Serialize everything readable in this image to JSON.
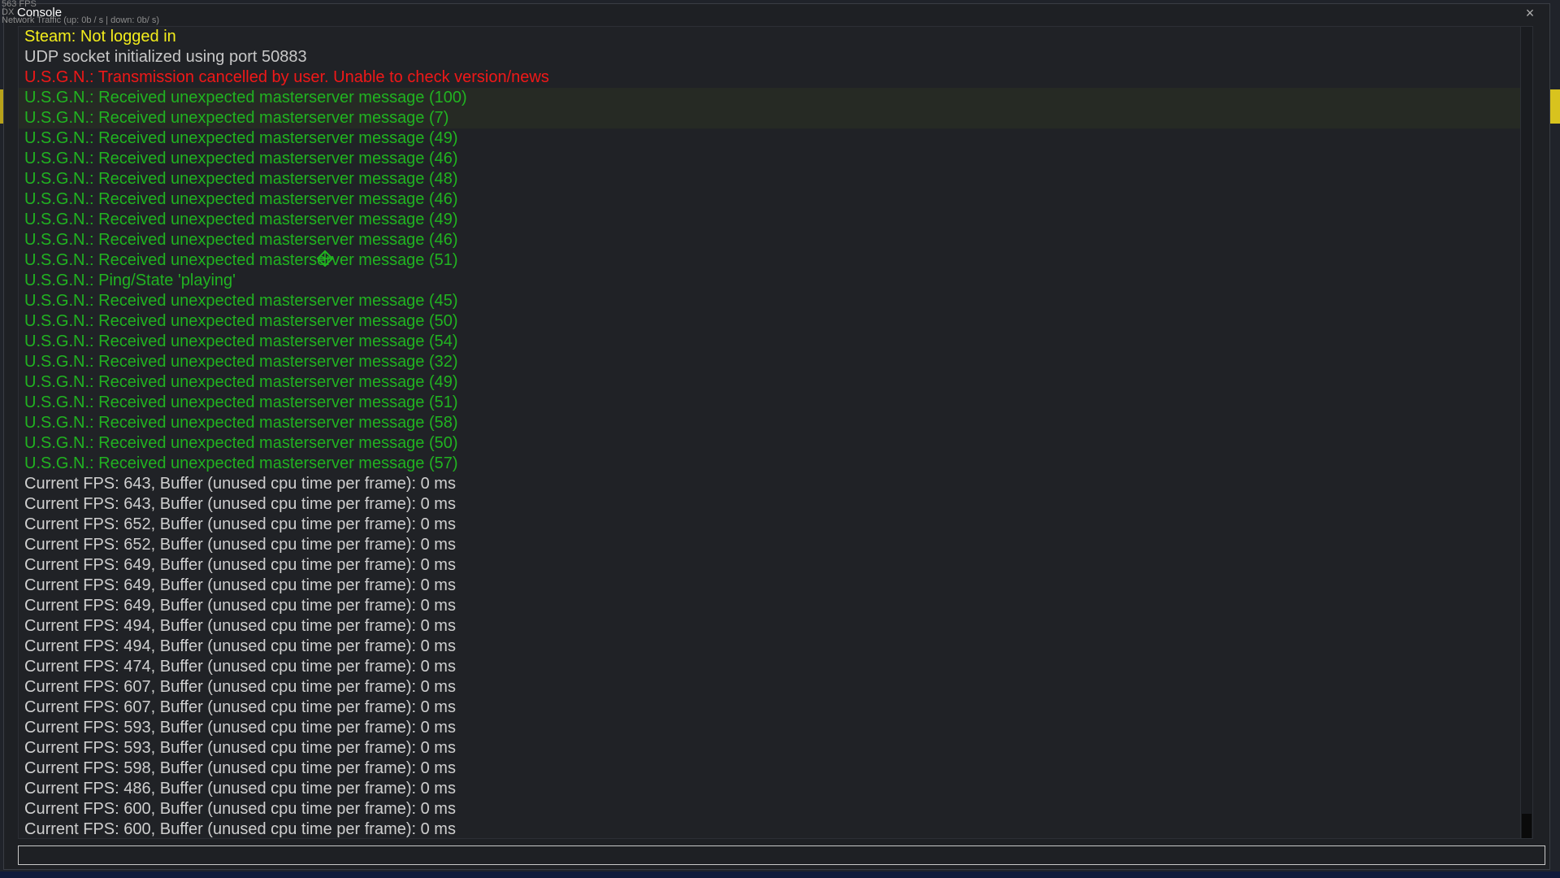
{
  "hud": {
    "fps": "563 FPS",
    "renderer": "DX",
    "network": "Network Traffic (up: 0b / s | down: 0b/ s)"
  },
  "window": {
    "title": "Console",
    "close_label": "×"
  },
  "colors": {
    "yellow": "#f4ee1c",
    "gray": "#c8c8c8",
    "red": "#f01818",
    "green": "#21b321"
  },
  "log": [
    {
      "text": "Steam: Not logged in",
      "color": "yellow"
    },
    {
      "text": "UDP socket initialized using port 50883",
      "color": "gray"
    },
    {
      "text": "U.S.G.N.: Transmission cancelled by user. Unable to check version/news",
      "color": "red"
    },
    {
      "text": "U.S.G.N.: Received unexpected masterserver message (100)",
      "color": "green",
      "highlight": true
    },
    {
      "text": "U.S.G.N.: Received unexpected masterserver message (7)",
      "color": "green",
      "highlight": true
    },
    {
      "text": "U.S.G.N.: Received unexpected masterserver message (49)",
      "color": "green"
    },
    {
      "text": "U.S.G.N.: Received unexpected masterserver message (46)",
      "color": "green"
    },
    {
      "text": "U.S.G.N.: Received unexpected masterserver message (48)",
      "color": "green"
    },
    {
      "text": "U.S.G.N.: Received unexpected masterserver message (46)",
      "color": "green"
    },
    {
      "text": "U.S.G.N.: Received unexpected masterserver message (49)",
      "color": "green"
    },
    {
      "text": "U.S.G.N.: Received unexpected masterserver message (46)",
      "color": "green"
    },
    {
      "text": "U.S.G.N.: Received unexpected masterserver message (51)",
      "color": "green"
    },
    {
      "text": "U.S.G.N.: Ping/State 'playing'",
      "color": "green"
    },
    {
      "text": "U.S.G.N.: Received unexpected masterserver message (45)",
      "color": "green"
    },
    {
      "text": "U.S.G.N.: Received unexpected masterserver message (50)",
      "color": "green"
    },
    {
      "text": "U.S.G.N.: Received unexpected masterserver message (54)",
      "color": "green"
    },
    {
      "text": "U.S.G.N.: Received unexpected masterserver message (32)",
      "color": "green"
    },
    {
      "text": "U.S.G.N.: Received unexpected masterserver message (49)",
      "color": "green"
    },
    {
      "text": "U.S.G.N.: Received unexpected masterserver message (51)",
      "color": "green"
    },
    {
      "text": "U.S.G.N.: Received unexpected masterserver message (58)",
      "color": "green"
    },
    {
      "text": "U.S.G.N.: Received unexpected masterserver message (50)",
      "color": "green"
    },
    {
      "text": "U.S.G.N.: Received unexpected masterserver message (57)",
      "color": "green"
    },
    {
      "text": "Current FPS: 643, Buffer (unused cpu time per frame): 0 ms",
      "color": "white"
    },
    {
      "text": "Current FPS: 643, Buffer (unused cpu time per frame): 0 ms",
      "color": "white"
    },
    {
      "text": "Current FPS: 652, Buffer (unused cpu time per frame): 0 ms",
      "color": "white"
    },
    {
      "text": "Current FPS: 652, Buffer (unused cpu time per frame): 0 ms",
      "color": "white"
    },
    {
      "text": "Current FPS: 649, Buffer (unused cpu time per frame): 0 ms",
      "color": "white"
    },
    {
      "text": "Current FPS: 649, Buffer (unused cpu time per frame): 0 ms",
      "color": "white"
    },
    {
      "text": "Current FPS: 649, Buffer (unused cpu time per frame): 0 ms",
      "color": "white"
    },
    {
      "text": "Current FPS: 494, Buffer (unused cpu time per frame): 0 ms",
      "color": "white"
    },
    {
      "text": "Current FPS: 494, Buffer (unused cpu time per frame): 0 ms",
      "color": "white"
    },
    {
      "text": "Current FPS: 474, Buffer (unused cpu time per frame): 0 ms",
      "color": "white"
    },
    {
      "text": "Current FPS: 607, Buffer (unused cpu time per frame): 0 ms",
      "color": "white"
    },
    {
      "text": "Current FPS: 607, Buffer (unused cpu time per frame): 0 ms",
      "color": "white"
    },
    {
      "text": "Current FPS: 593, Buffer (unused cpu time per frame): 0 ms",
      "color": "white"
    },
    {
      "text": "Current FPS: 593, Buffer (unused cpu time per frame): 0 ms",
      "color": "white"
    },
    {
      "text": "Current FPS: 598, Buffer (unused cpu time per frame): 0 ms",
      "color": "white"
    },
    {
      "text": "Current FPS: 486, Buffer (unused cpu time per frame): 0 ms",
      "color": "white"
    },
    {
      "text": "Current FPS: 600, Buffer (unused cpu time per frame): 0 ms",
      "color": "white"
    },
    {
      "text": "Current FPS: 600, Buffer (unused cpu time per frame): 0 ms",
      "color": "white"
    }
  ],
  "input": {
    "value": "",
    "placeholder": ""
  },
  "icons": {
    "cursor": "crosshair-cursor-icon",
    "close": "close-icon"
  }
}
